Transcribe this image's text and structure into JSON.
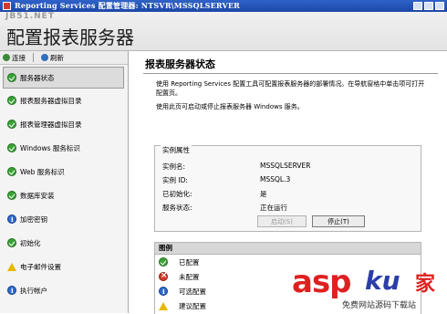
{
  "window": {
    "title": "Reporting Services 配置管理器: NTSVR\\MSSQLSERVER"
  },
  "header": {
    "watermark_text": "JB51.NET",
    "page_title": "配置报表服务器"
  },
  "toolbar": {
    "connect_label": "连接",
    "connect_icon": "connect-icon",
    "refresh_label": "刷新",
    "refresh_icon": "refresh-icon"
  },
  "sidebar": {
    "items": [
      {
        "label": "服务器状态",
        "status": "ok",
        "selected": true
      },
      {
        "label": "报表服务器虚拟目录",
        "status": "ok"
      },
      {
        "label": "报表管理器虚拟目录",
        "status": "ok"
      },
      {
        "label": "Windows 服务标识",
        "status": "ok"
      },
      {
        "label": "Web 服务标识",
        "status": "ok"
      },
      {
        "label": "数据库安装",
        "status": "ok"
      },
      {
        "label": "加密密钥",
        "status": "info"
      },
      {
        "label": "初始化",
        "status": "ok"
      },
      {
        "label": "电子邮件设置",
        "status": "warn"
      },
      {
        "label": "执行帐户",
        "status": "info"
      }
    ]
  },
  "main": {
    "section_title": "报表服务器状态",
    "desc1": "使用 Reporting Services 配置工具可配置报表服务器的部署情况。在导航窗格中单击项可打开配置页。",
    "desc2": "使用此页可启动或停止报表服务器 Windows 服务。",
    "instance": {
      "group_title": "实例属性",
      "rows": [
        {
          "key": "实例名:",
          "value": "MSSQLSERVER"
        },
        {
          "key": "实例 ID:",
          "value": "MSSQL.3"
        },
        {
          "key": "已初始化:",
          "value": "是"
        },
        {
          "key": "服务状态:",
          "value": "正在运行"
        }
      ],
      "start_button": "启动(S)",
      "stop_button": "停止(T)"
    },
    "legend": {
      "title": "图例",
      "items": [
        {
          "label": "已配置",
          "status": "ok"
        },
        {
          "label": "未配置",
          "status": "err"
        },
        {
          "label": "可选配置",
          "status": "info"
        },
        {
          "label": "建议配置",
          "status": "warn"
        }
      ]
    }
  },
  "watermark": {
    "brand_asp": "asp",
    "brand_ku": "ku",
    "brand_jia": "家",
    "subtitle": "免费网站源码下载站"
  },
  "colors": {
    "titlebar": "#1d47a8",
    "ok": "#3aa336",
    "info": "#2e6ad1",
    "warn": "#e6b800",
    "err": "#d8392b",
    "watermark_red": "#e02020",
    "watermark_blue": "#2b3ea8"
  }
}
